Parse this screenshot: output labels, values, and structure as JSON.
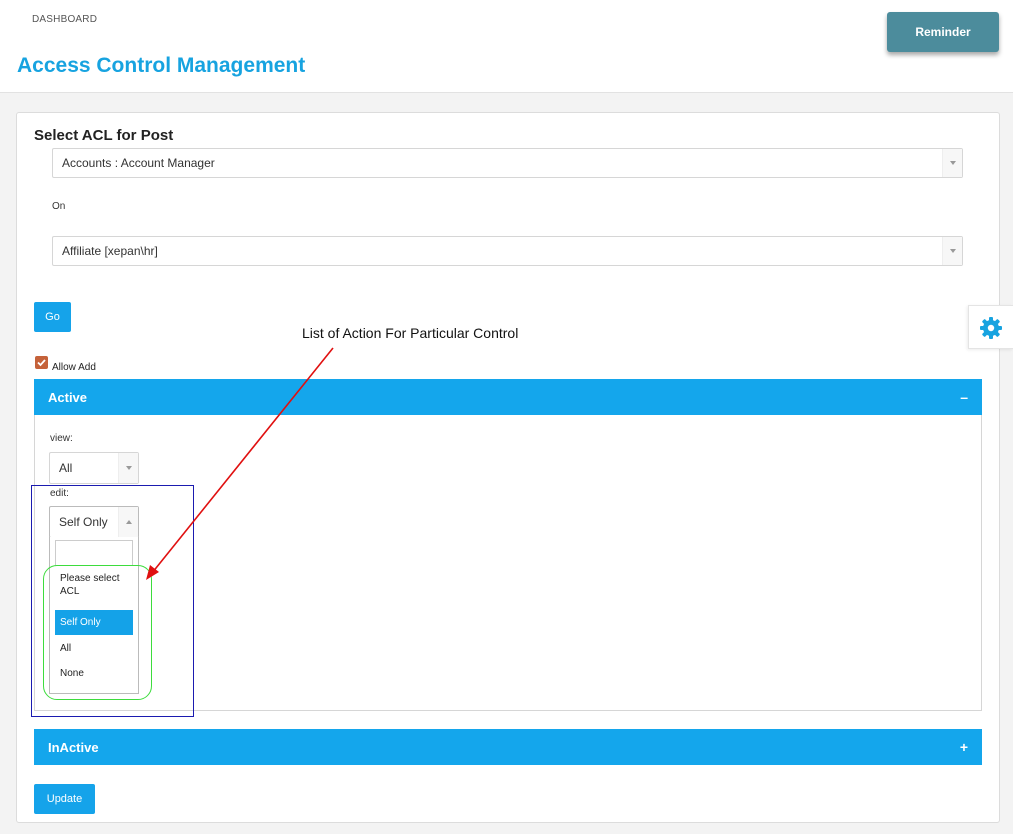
{
  "header": {
    "breadcrumb": "DASHBOARD",
    "title": "Access Control Management",
    "reminder_label": "Reminder"
  },
  "form": {
    "section_title": "Select ACL for Post",
    "post_select_value": "Accounts : Account Manager",
    "on_label": "On",
    "model_select_value": "Affiliate [xepan\\hr]",
    "go_label": "Go",
    "allow_add_label": "Allow Add",
    "allow_add_checked": true,
    "update_label": "Update"
  },
  "annotation": {
    "text": "List of Action For Particular Control",
    "arrow_color": "#e01010",
    "outer_box_color": "#1b1bb0",
    "options_box_color": "#3ddc3d"
  },
  "accordion": {
    "active": {
      "label": "Active",
      "toggle": "–"
    },
    "inactive": {
      "label": "InActive",
      "toggle": "+"
    }
  },
  "fields": {
    "view": {
      "label": "view:",
      "value": "All"
    },
    "edit": {
      "label": "edit:",
      "value": "Self Only",
      "options": [
        {
          "label": "Please select ACL",
          "selected": false
        },
        {
          "label": "Self Only",
          "selected": true
        },
        {
          "label": "All",
          "selected": false
        },
        {
          "label": "None",
          "selected": false
        }
      ]
    }
  },
  "icons": {
    "settings": "gear-icon",
    "checkbox": "checkmark-icon",
    "select_caret": "caret-down-icon"
  },
  "colors": {
    "accent": "#14a6ec",
    "title": "#17a3e0",
    "reminder": "#4c8c9c",
    "checkbox": "#c5623a"
  }
}
